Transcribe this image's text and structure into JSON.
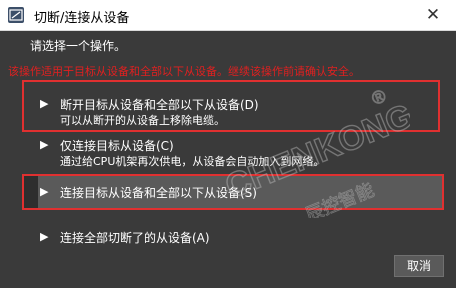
{
  "window": {
    "title": "切断/连接从设备",
    "close_glyph": "✕"
  },
  "prompt": "请选择一个操作。",
  "warning": "该操作适用于目标从设备和全部以下从设备。继续该操作前请确认安全。",
  "options": [
    {
      "title": "断开目标从设备和全部以下从设备(D)",
      "desc": "可以从断开的从设备上移除电缆。"
    },
    {
      "title": "仅连接目标从设备(C)",
      "desc": "通过给CPU机架再次供电，从设备会自动加入到网络。"
    },
    {
      "title": "连接目标从设备和全部以下从设备(S)"
    },
    {
      "title": "连接全部切断了的从设备(A)"
    }
  ],
  "arrow_glyph": "▶",
  "watermark": {
    "brand": "CHENKONG",
    "cn": "辰控智能",
    "reg": "®"
  },
  "cancel_label": "取消",
  "colors": {
    "background": "#3a3a3a",
    "highlight_border": "#e03030",
    "warning_text": "#e02020"
  }
}
